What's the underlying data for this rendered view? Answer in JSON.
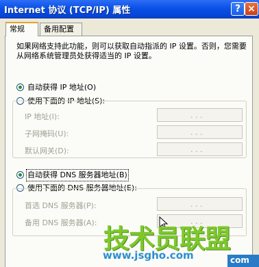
{
  "window": {
    "title": "Internet 协议 (TCP/IP) 属性",
    "help_button": "?",
    "close_button": "×"
  },
  "tabs": [
    {
      "label": "常规",
      "active": true
    },
    {
      "label": "备用配置",
      "active": false
    }
  ],
  "description": "如果网络支持此功能，则可以获取自动指派的 IP 设置。否则，您需要从网络系统管理员处获得适当的 IP 设置。",
  "ip_mode": {
    "auto_label": "自动获得 IP 地址(O)",
    "manual_label": "使用下面的 IP 地址(S):",
    "selected": "auto"
  },
  "ip_fields": [
    {
      "label": "IP 地址(I):",
      "value": ". . ."
    },
    {
      "label": "子网掩码(U):",
      "value": ". . ."
    },
    {
      "label": "默认网关(D):",
      "value": ". . ."
    }
  ],
  "dns_mode": {
    "auto_label": "自动获得 DNS 服务器地址(B)",
    "manual_label": "使用下面的 DNS 服务器地址(E):",
    "selected": "auto"
  },
  "dns_fields": [
    {
      "label": "首选 DNS 服务器(P):",
      "value": ". . ."
    },
    {
      "label": "备用 DNS 服务器(A):",
      "value": ". . ."
    }
  ],
  "watermark": {
    "chinese": "技术员联盟",
    "url": "www.jsgho.com",
    "suffix": "com"
  },
  "colors": {
    "titlebar": "#0a52e7",
    "panel": "#fbfbf8",
    "radio_dot": "#2b8f2b",
    "watermark_green": "#7ec82c",
    "watermark_blue": "#2a8fd0"
  }
}
